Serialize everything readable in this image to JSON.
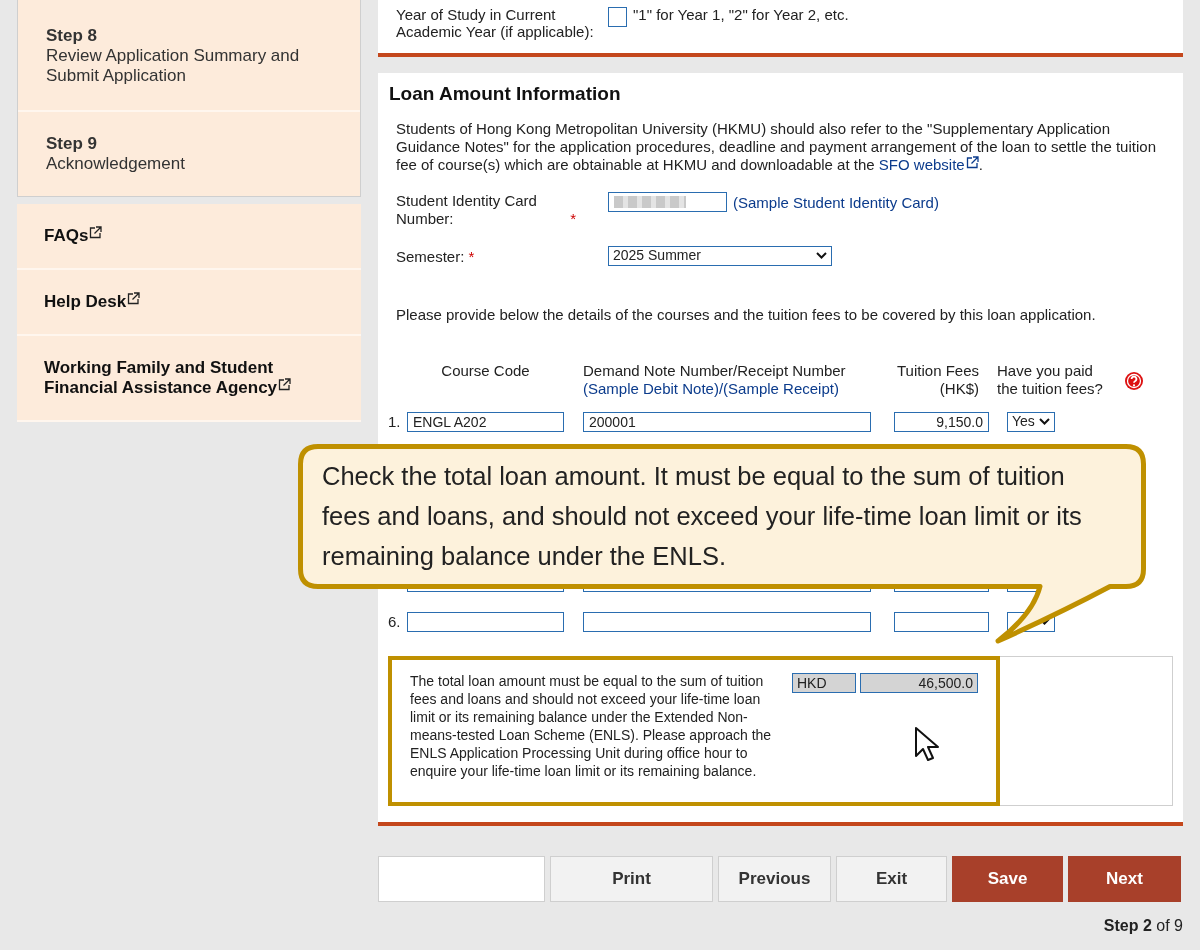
{
  "sidebar": {
    "steps": [
      {
        "title": "Step 8",
        "label": "Review Application Summary and Submit Application"
      },
      {
        "title": "Step 9",
        "label": "Acknowledgement"
      }
    ],
    "links": [
      {
        "label": "FAQs"
      },
      {
        "label": "Help Desk"
      },
      {
        "label": "Working Family and Student Financial Assistance Agency"
      }
    ]
  },
  "year_of_study": {
    "label": "Year of Study in Current Academic Year (if applicable):",
    "hint": "\"1\" for Year 1, \"2\" for Year 2, etc."
  },
  "loan_section": {
    "title": "Loan Amount Information",
    "intro": "Students of Hong Kong Metropolitan University (HKMU) should also refer to the \"Supplementary Application Guidance Notes\" for the application procedures, deadline and payment arrangement of the loan to settle the tuition fee of course(s) which are obtainable at HKMU and downloadable at the ",
    "intro_link": "SFO website",
    "intro_end": ".",
    "id_card": {
      "label": "Student Identity Card Number:",
      "required_mark": "*",
      "sample_link": "(Sample Student Identity Card)"
    },
    "semester": {
      "label": "Semester:",
      "required_mark": "*",
      "value": "2025 Summer"
    },
    "courses_prompt": "Please provide below the details of the courses and the tuition fees to be covered by this loan application.",
    "columns": {
      "course_code": "Course Code",
      "note": "Demand Note Number/Receipt Number",
      "note_link_1": "(Sample Debit Note)",
      "note_separator": "/",
      "note_link_2": "(Sample Receipt)",
      "fees": "Tuition Fees",
      "fees_unit": "(HK$)",
      "paid": "Have you paid the tuition fees?"
    },
    "rows": [
      {
        "kind": "full",
        "number": "1.",
        "course_code": "ENGL A202",
        "note_number": "200001",
        "fees": "9,150.0",
        "paid": "Yes"
      },
      {
        "kind": "covered"
      },
      {
        "kind": "partial"
      },
      {
        "kind": "partial",
        "number": "6."
      }
    ],
    "total": {
      "note": "The total loan amount must be equal to the sum of tuition fees and loans and should not exceed your life-time loan limit or its remaining balance under the Extended Non-means-tested Loan Scheme (ENLS). Please approach the ENLS Application Processing Unit during office hour to enquire your life-time loan limit or its remaining balance.",
      "currency": "HKD",
      "amount": "46,500.0"
    }
  },
  "callout": {
    "text": "Check the total loan amount. It must be equal to the sum of tuition fees and loans, and should not exceed your life-time loan limit or its remaining balance under the ENLS."
  },
  "buttons": [
    {
      "label": "Print",
      "kind": "default"
    },
    {
      "label": "Previous",
      "kind": "default"
    },
    {
      "label": "Exit",
      "kind": "default"
    },
    {
      "label": "Save",
      "kind": "primary"
    },
    {
      "label": "Next",
      "kind": "primary"
    }
  ],
  "step_indicator": "**Step 2** of 9"
}
